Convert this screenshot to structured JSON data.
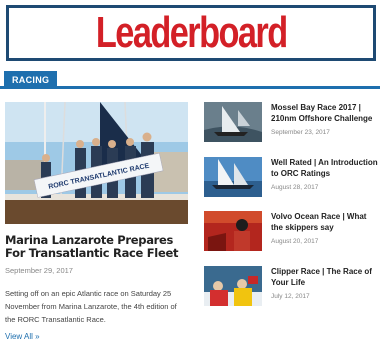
{
  "masthead": {
    "title": "Leaderboard"
  },
  "section": {
    "tab_label": "RACING"
  },
  "feature": {
    "title": "Marina Lanzarote Prepares For Transatlantic Race Fleet",
    "date": "September 29, 2017",
    "excerpt": "Setting off on an epic Atlantic race on Saturday 25 November from Marina Lanzarote, the 4th edition of the RORC Transatlantic Race.",
    "view_all": "View All »",
    "banner_text": "RORC TRANSATLANTIC RACE"
  },
  "articles": [
    {
      "title": "Mossel Bay Race 2017 | 210nm Offshore Challenge",
      "date": "September 23, 2017"
    },
    {
      "title": "Well Rated | An Introduction to ORC Ratings",
      "date": "August 28, 2017"
    },
    {
      "title": "Volvo Ocean Race | What the skippers say",
      "date": "August 20, 2017"
    },
    {
      "title": "Clipper Race | The Race of Your Life",
      "date": "July 12, 2017"
    }
  ],
  "colors": {
    "brand_red": "#d32027",
    "accent_blue": "#1e6fae",
    "frame_navy": "#1e4a73"
  }
}
